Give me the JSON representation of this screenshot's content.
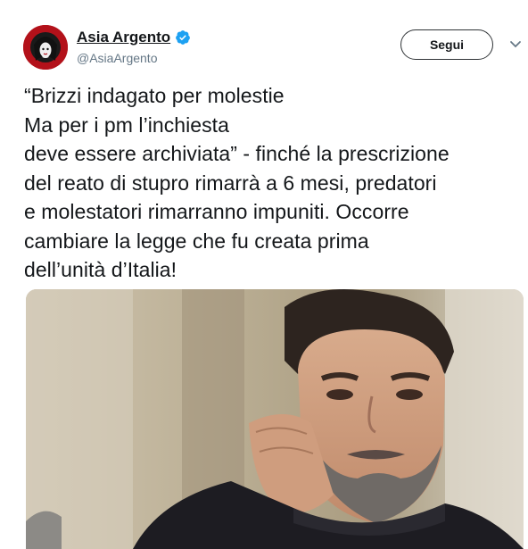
{
  "tweet": {
    "author": {
      "display_name": "Asia Argento",
      "handle": "@AsiaArgento",
      "verified": true,
      "avatar_icon": "avatar-icon"
    },
    "follow_button": "Segui",
    "menu_icon": "chevron-down-icon",
    "text_lines": [
      "“Brizzi indagato per molestie",
      "Ma per i pm l’inchiesta",
      "deve essere archiviata” - finché la prescrizione",
      "del reato di stupro rimarrà a 6 mesi, predatori",
      "e molestatori rimarranno impuniti. Occorre",
      "cambiare la legge che fu creata prima",
      "dell’unità d’Italia!"
    ],
    "media_icon": "photo-icon"
  },
  "colors": {
    "text": "#14171a",
    "secondary": "#657786",
    "verified": "#1da1f2",
    "avatar_bg": "#b3111a"
  }
}
